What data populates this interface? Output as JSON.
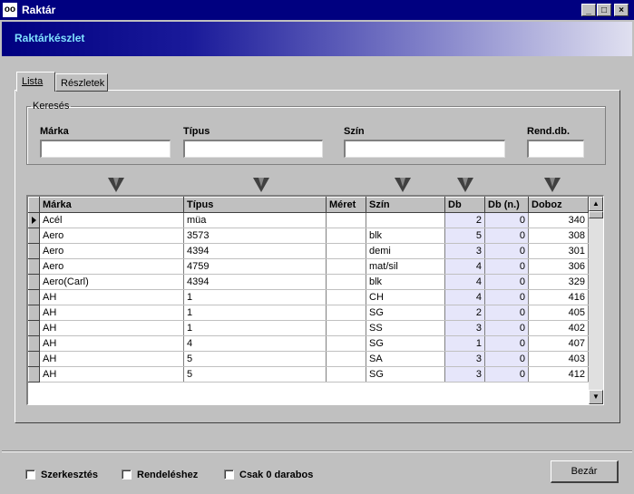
{
  "window": {
    "title": "Raktár",
    "icon": "glasses-icon"
  },
  "banner": {
    "title": "Raktárkészlet"
  },
  "tabs": [
    {
      "label": "Lista"
    },
    {
      "label": "Részletek"
    }
  ],
  "search": {
    "legend": "Keresés",
    "fields": [
      {
        "label": "Márka",
        "value": ""
      },
      {
        "label": "Típus",
        "value": ""
      },
      {
        "label": "Szín",
        "value": ""
      },
      {
        "label": "Rend.db.",
        "value": ""
      }
    ]
  },
  "grid": {
    "columns": [
      "Márka",
      "Típus",
      "Méret",
      "Szín",
      "Db",
      "Db (n.)",
      "Doboz"
    ],
    "rows": [
      [
        "Acél",
        "müa",
        "",
        "",
        "2",
        "0",
        "340"
      ],
      [
        "Aero",
        "3573",
        "",
        "blk",
        "5",
        "0",
        "308"
      ],
      [
        "Aero",
        "4394",
        "",
        "demi",
        "3",
        "0",
        "301"
      ],
      [
        "Aero",
        "4759",
        "",
        "mat/sil",
        "4",
        "0",
        "306"
      ],
      [
        "Aero(Carl)",
        "4394",
        "",
        "blk",
        "4",
        "0",
        "329"
      ],
      [
        "AH",
        "1",
        "",
        "CH",
        "4",
        "0",
        "416"
      ],
      [
        "AH",
        "1",
        "",
        "SG",
        "2",
        "0",
        "405"
      ],
      [
        "AH",
        "1",
        "",
        "SS",
        "3",
        "0",
        "402"
      ],
      [
        "AH",
        "4",
        "",
        "SG",
        "1",
        "0",
        "407"
      ],
      [
        "AH",
        "5",
        "",
        "SA",
        "3",
        "0",
        "403"
      ],
      [
        "AH",
        "5",
        "",
        "SG",
        "3",
        "0",
        "412"
      ]
    ]
  },
  "footer": {
    "checkboxes": [
      {
        "label": "Szerkesztés",
        "checked": false
      },
      {
        "label": "Rendeléshez",
        "checked": false
      },
      {
        "label": "Csak 0 darabos",
        "checked": false
      }
    ],
    "close_label": "Bezár"
  }
}
